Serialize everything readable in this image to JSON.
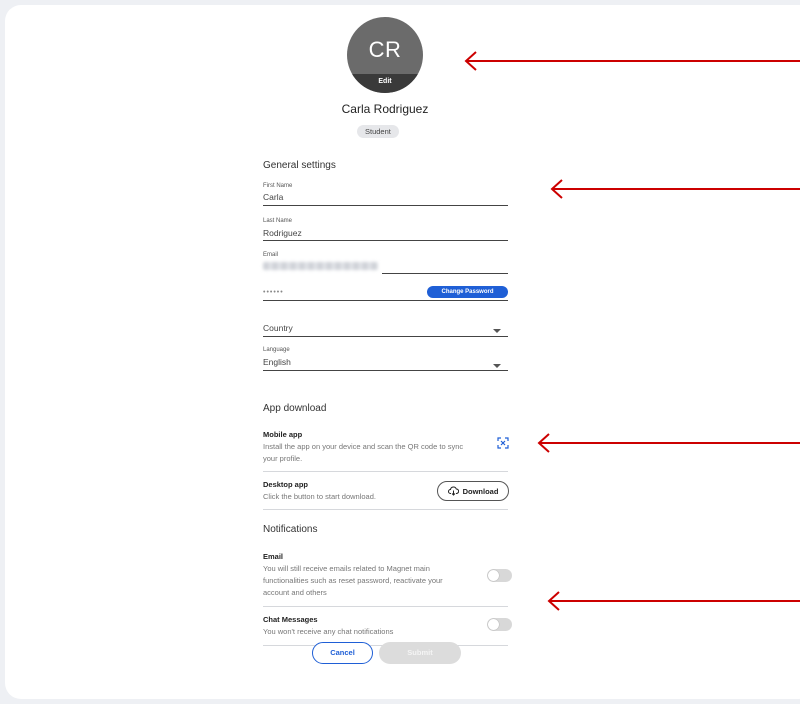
{
  "profile": {
    "initials": "CR",
    "edit_label": "Edit",
    "name": "Carla Rodriguez",
    "role": "Student"
  },
  "general": {
    "title": "General settings",
    "first_name_label": "First Name",
    "first_name_value": "Carla",
    "last_name_label": "Last Name",
    "last_name_value": "Rodriguez",
    "email_label": "Email",
    "password_mask": "••••••",
    "change_password_label": "Change Password",
    "country_placeholder": "Country",
    "language_label": "Language",
    "language_value": "English"
  },
  "app_download": {
    "title": "App download",
    "mobile_title": "Mobile app",
    "mobile_desc_1": "Install the app on your device and scan the QR code to sync",
    "mobile_desc_2": "your profile.",
    "desktop_title": "Desktop app",
    "desktop_desc": "Click the button to start download.",
    "download_label": "Download"
  },
  "notifications": {
    "title": "Notifications",
    "email_title": "Email",
    "email_desc_1": "You will still receive emails related to Magnet main",
    "email_desc_2": "functionalities such as reset password, reactivate your",
    "email_desc_3": "account and others",
    "email_enabled": false,
    "chat_title": "Chat Messages",
    "chat_desc": "You won't receive any chat notifications",
    "chat_enabled": false
  },
  "actions": {
    "cancel_label": "Cancel",
    "submit_label": "Submit"
  },
  "icons": {
    "qr": "qr-scan-icon",
    "download": "cloud-download-icon",
    "dropdown": "caret-down-icon",
    "annotation_arrow": "arrow-left-icon"
  },
  "colors": {
    "accent": "#1f5fd6",
    "annotation": "#cc0000"
  }
}
